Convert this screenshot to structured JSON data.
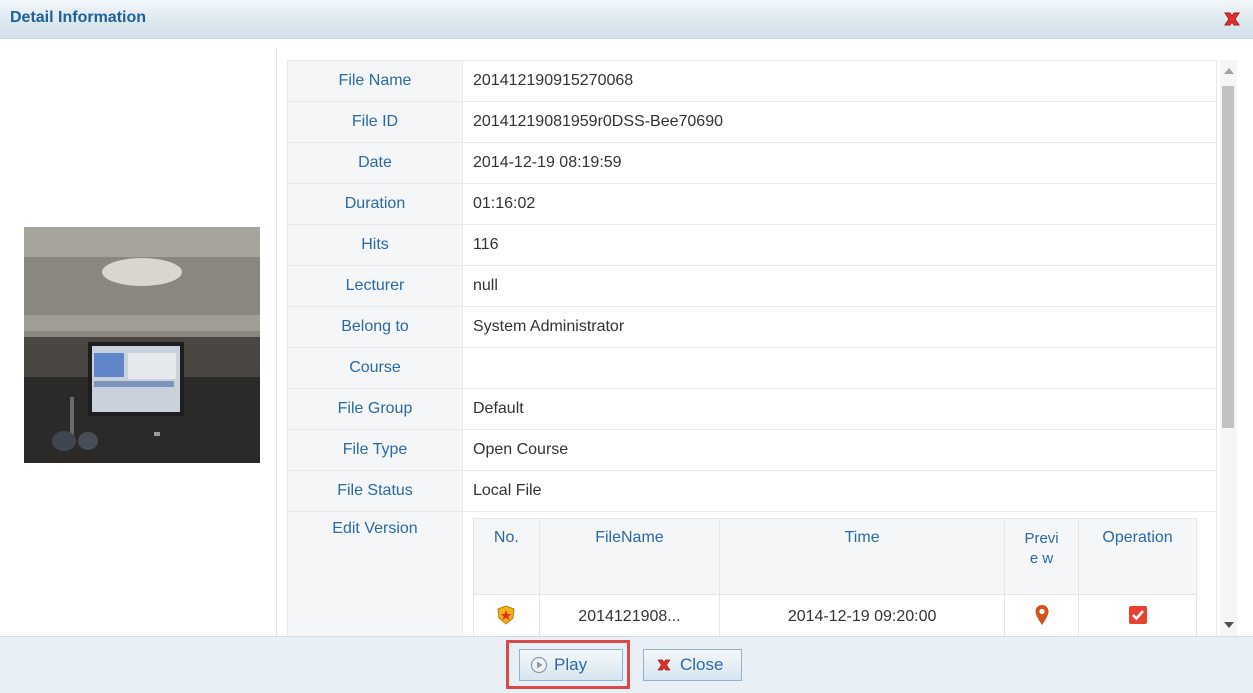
{
  "dialog": {
    "title": "Detail Information",
    "close_icon": "close-x-icon"
  },
  "details": [
    {
      "label": "File Name",
      "value": "201412190915270068"
    },
    {
      "label": "File ID",
      "value": "20141219081959r0DSS-Bee70690"
    },
    {
      "label": "Date",
      "value": "2014-12-19 08:19:59"
    },
    {
      "label": "Duration",
      "value": "01:16:02"
    },
    {
      "label": "Hits",
      "value": "116"
    },
    {
      "label": "Lecturer",
      "value": "null"
    },
    {
      "label": "Belong to",
      "value": "System Administrator"
    },
    {
      "label": "Course",
      "value": ""
    },
    {
      "label": "File Group",
      "value": "Default"
    },
    {
      "label": "File Type",
      "value": "Open Course"
    },
    {
      "label": "File Status",
      "value": "Local File"
    }
  ],
  "edit_version": {
    "label": "Edit Version",
    "headers": {
      "no": "No.",
      "filename": "FileName",
      "time": "Time",
      "preview": "Previe w",
      "operation": "Operation"
    },
    "rows": [
      {
        "no_icon": "badge-icon",
        "filename": "2014121908...",
        "time": "2014-12-19 09:20:00",
        "preview_icon": "location-pin-icon",
        "operation_icon": "checkbox-checked-icon"
      }
    ]
  },
  "footer": {
    "play_label": "Play",
    "close_label": "Close"
  },
  "colors": {
    "accent": "#2d6aa3",
    "highlight": "#d94b4b"
  }
}
